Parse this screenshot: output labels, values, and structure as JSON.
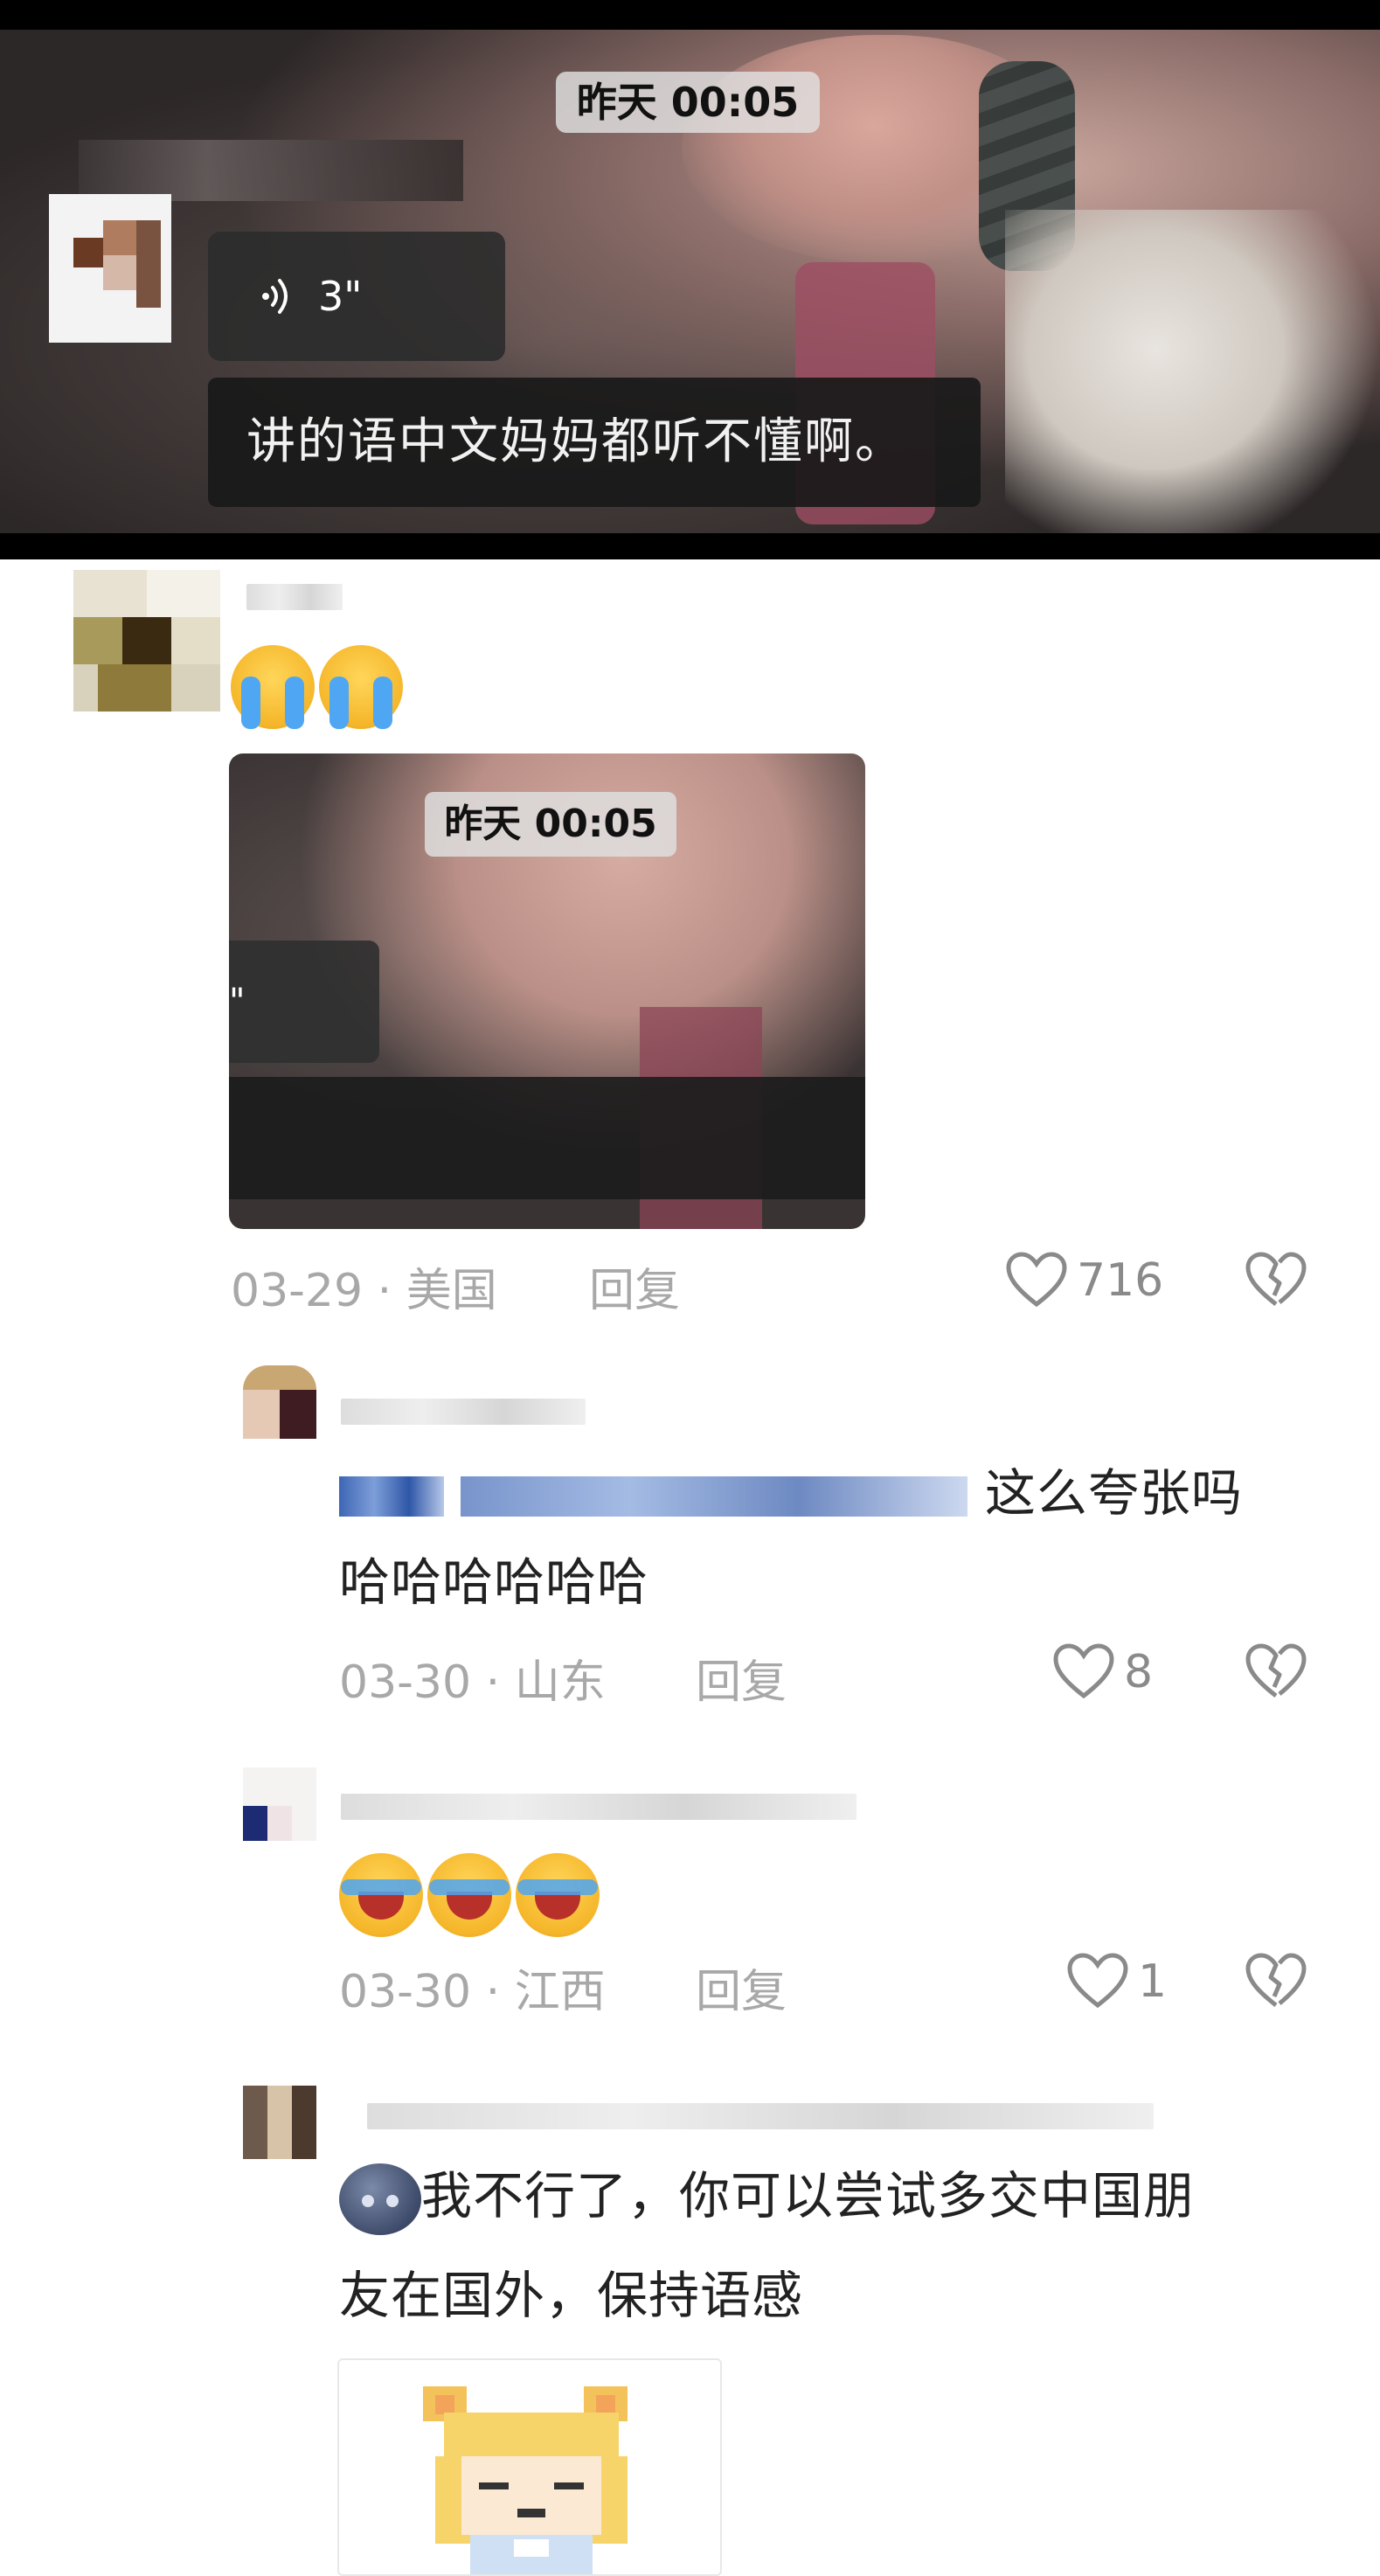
{
  "video": {
    "timestamp": "昨天 00:05",
    "voice_duration": "3\"",
    "caption": "讲的语中文妈妈都听不懂啊。"
  },
  "comments": [
    {
      "emoji": [
        "loudly-crying-face",
        "loudly-crying-face"
      ],
      "image_thumb": {
        "timestamp": "昨天 00:05",
        "voice_duration": "\"",
        "caption": ""
      },
      "date": "03-29",
      "location": "美国",
      "reply_label": "回复",
      "likes": "716"
    },
    {
      "text_visible": "这么夸张吗",
      "text_line2": "哈哈哈哈哈哈",
      "date": "03-30",
      "location": "山东",
      "reply_label": "回复",
      "likes": "8"
    },
    {
      "emoji": [
        "rolling-laugh-face",
        "rolling-laugh-face",
        "rolling-laugh-face"
      ],
      "date": "03-30",
      "location": "江西",
      "reply_label": "回复",
      "likes": "1"
    },
    {
      "emoji_prefix": "moon-face",
      "text_line1": "我不行了，你可以尝试多交中国朋",
      "text_line2": "友在国外，保持语感",
      "sticker": "pixel-cat-girl-sticker"
    }
  ],
  "separator": "·",
  "colors": {
    "meta_gray": "#a8a8a8",
    "text_dark": "#222222",
    "caption_bg": "#191919"
  }
}
